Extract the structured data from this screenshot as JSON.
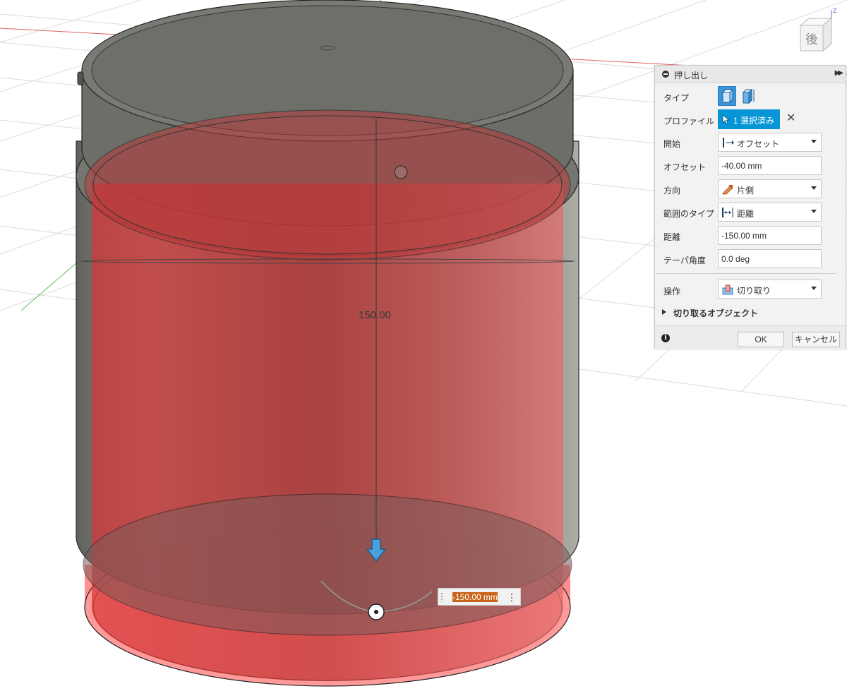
{
  "viewport": {
    "viewcube_face": "後",
    "axis_label": "Z",
    "dimension_label": "150.00",
    "value_input": "-150.00 mm"
  },
  "panel": {
    "title": "押し出し",
    "rows": {
      "type_label": "タイプ",
      "profile_label": "プロファイル",
      "profile_value": "1 選択済み",
      "start_label": "開始",
      "start_value": "オフセット",
      "offset_label": "オフセット",
      "offset_value": "-40.00 mm",
      "direction_label": "方向",
      "direction_value": "片側",
      "extent_label": "範囲のタイプ",
      "extent_value": "距離",
      "distance_label": "距離",
      "distance_value": "-150.00 mm",
      "taper_label": "テーパ角度",
      "taper_value": "0.0 deg",
      "operation_label": "操作",
      "operation_value": "切り取り"
    },
    "section_label": "切り取るオブジェクト",
    "ok_label": "OK",
    "cancel_label": "キャンセル",
    "info_glyph": "i"
  },
  "colors": {
    "accent": "#0696d7",
    "cut_red": "#e23b3b",
    "body_gray": "#6b6b66",
    "x_axis": "#e05050",
    "y_axis": "#4caf50",
    "input_highlight": "#c8641b"
  }
}
